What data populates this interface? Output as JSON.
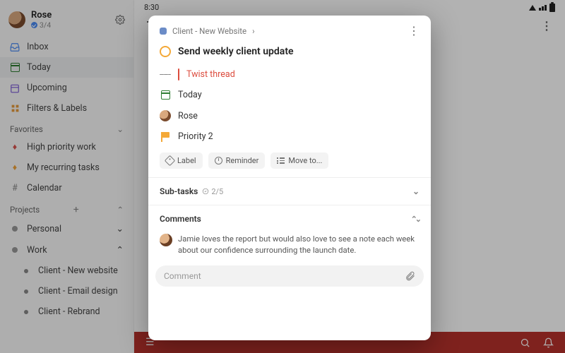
{
  "statusbar": {
    "time": "8:30"
  },
  "user": {
    "name": "Rose",
    "progress": "3/4"
  },
  "nav": {
    "inbox": "Inbox",
    "today": "Today",
    "upcoming": "Upcoming",
    "filters": "Filters & Labels"
  },
  "sections": {
    "favorites": "Favorites",
    "projects": "Projects"
  },
  "favorites": {
    "high_priority": "High priority work",
    "recurring": "My recurring tasks",
    "calendar": "Calendar"
  },
  "projects": {
    "personal": "Personal",
    "work": "Work",
    "work_children": {
      "new_website": "Client - New website",
      "email_design": "Client - Email design",
      "rebrand": "Client - Rebrand"
    }
  },
  "main": {
    "title_initial": "T"
  },
  "task": {
    "breadcrumb": "Client - New Website",
    "title": "Send weekly client update",
    "twist": "Twist thread",
    "due": "Today",
    "assignee": "Rose",
    "priority": "Priority 2",
    "actions": {
      "label": "Label",
      "reminder": "Reminder",
      "move": "Move to..."
    },
    "subtasks_label": "Sub-tasks",
    "subtasks_count": "2/5",
    "comments_label": "Comments",
    "comment_text": "Jamie loves the report but would also love to see a note each week about our confidence surrounding the launch date.",
    "composer_placeholder": "Comment"
  }
}
